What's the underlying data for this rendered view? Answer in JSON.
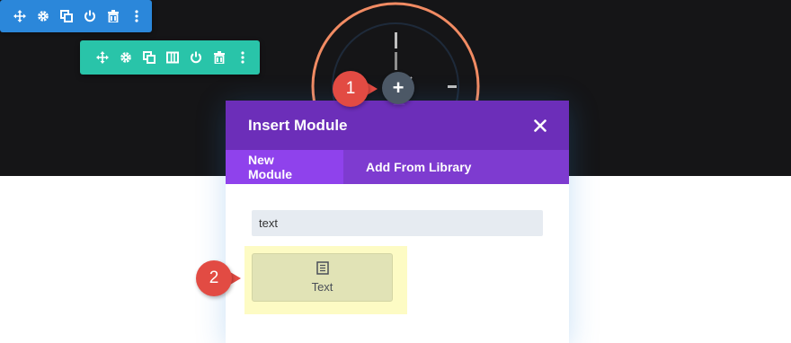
{
  "colors": {
    "section_toolbar": "#2b87da",
    "row_toolbar": "#29c4a9",
    "modal_header": "#6c2eb9",
    "modal_tabs": "#7e3bd0",
    "active_tab": "#8f42ec",
    "marker": "#e24b43",
    "highlight": "#fdfbc4"
  },
  "section_toolbar": {
    "icons": [
      "move-icon",
      "gear-icon",
      "duplicate-icon",
      "power-icon",
      "trash-icon",
      "more-icon"
    ]
  },
  "row_toolbar": {
    "icons": [
      "move-icon",
      "gear-icon",
      "duplicate-icon",
      "columns-icon",
      "power-icon",
      "trash-icon",
      "more-icon"
    ]
  },
  "add_button": {
    "label": "+"
  },
  "markers": [
    {
      "label": "1"
    },
    {
      "label": "2"
    }
  ],
  "modal": {
    "title": "Insert Module",
    "close_icon": "close-icon",
    "tabs": [
      {
        "label": "New Module",
        "active": true
      },
      {
        "label": "Add From Library",
        "active": false
      }
    ],
    "search": {
      "value": "text"
    },
    "modules": [
      {
        "label": "Text",
        "icon": "text-document-icon"
      }
    ]
  }
}
